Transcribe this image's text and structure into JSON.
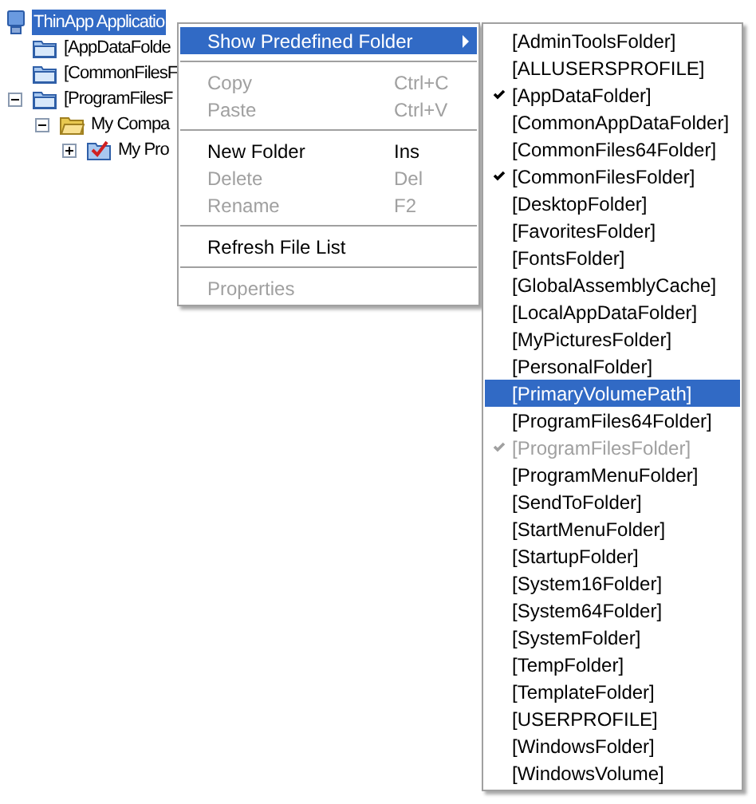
{
  "tree": [
    {
      "label": "ThinApp Applicatio",
      "kind": "computer",
      "selected": true,
      "children": [
        {
          "label": "[AppDataFolde",
          "kind": "folder",
          "selected": false
        },
        {
          "label": "[CommonFilesF",
          "kind": "folder",
          "selected": false
        },
        {
          "label": "[ProgramFilesF",
          "kind": "folder",
          "selected": false,
          "expanded": true,
          "children": [
            {
              "label": "My Compa",
              "kind": "open-folder",
              "selected": false,
              "expanded": true,
              "children": [
                {
                  "label": "My Pro",
                  "kind": "checked-folder",
                  "selected": false,
                  "expanded": false
                }
              ]
            }
          ]
        }
      ]
    }
  ],
  "context_menu": [
    {
      "kind": "item",
      "label": "Show Predefined Folder",
      "selected": true,
      "disabled": false,
      "submenu": true
    },
    {
      "kind": "separator"
    },
    {
      "kind": "item",
      "label": "Copy",
      "shortcut": "Ctrl+C",
      "selected": false,
      "disabled": true
    },
    {
      "kind": "item",
      "label": "Paste",
      "shortcut": "Ctrl+V",
      "selected": false,
      "disabled": true
    },
    {
      "kind": "separator"
    },
    {
      "kind": "item",
      "label": "New Folder",
      "shortcut": "Ins",
      "selected": false,
      "disabled": false
    },
    {
      "kind": "item",
      "label": "Delete",
      "shortcut": "Del",
      "selected": false,
      "disabled": true
    },
    {
      "kind": "item",
      "label": "Rename",
      "shortcut": "F2",
      "selected": false,
      "disabled": true
    },
    {
      "kind": "separator"
    },
    {
      "kind": "item",
      "label": "Refresh File List",
      "selected": false,
      "disabled": false
    },
    {
      "kind": "separator"
    },
    {
      "kind": "item",
      "label": "Properties",
      "selected": false,
      "disabled": true
    }
  ],
  "submenu": [
    {
      "label": "[AdminToolsFolder]",
      "checked": false,
      "disabled": false,
      "selected": false
    },
    {
      "label": "[ALLUSERSPROFILE]",
      "checked": false,
      "disabled": false,
      "selected": false
    },
    {
      "label": "[AppDataFolder]",
      "checked": true,
      "disabled": false,
      "selected": false
    },
    {
      "label": "[CommonAppDataFolder]",
      "checked": false,
      "disabled": false,
      "selected": false
    },
    {
      "label": "[CommonFiles64Folder]",
      "checked": false,
      "disabled": false,
      "selected": false
    },
    {
      "label": "[CommonFilesFolder]",
      "checked": true,
      "disabled": false,
      "selected": false
    },
    {
      "label": "[DesktopFolder]",
      "checked": false,
      "disabled": false,
      "selected": false
    },
    {
      "label": "[FavoritesFolder]",
      "checked": false,
      "disabled": false,
      "selected": false
    },
    {
      "label": "[FontsFolder]",
      "checked": false,
      "disabled": false,
      "selected": false
    },
    {
      "label": "[GlobalAssemblyCache]",
      "checked": false,
      "disabled": false,
      "selected": false
    },
    {
      "label": "[LocalAppDataFolder]",
      "checked": false,
      "disabled": false,
      "selected": false
    },
    {
      "label": "[MyPicturesFolder]",
      "checked": false,
      "disabled": false,
      "selected": false
    },
    {
      "label": "[PersonalFolder]",
      "checked": false,
      "disabled": false,
      "selected": false
    },
    {
      "label": "[PrimaryVolumePath]",
      "checked": false,
      "disabled": false,
      "selected": true
    },
    {
      "label": "[ProgramFiles64Folder]",
      "checked": false,
      "disabled": false,
      "selected": false
    },
    {
      "label": "[ProgramFilesFolder]",
      "checked": true,
      "disabled": true,
      "selected": false
    },
    {
      "label": "[ProgramMenuFolder]",
      "checked": false,
      "disabled": false,
      "selected": false
    },
    {
      "label": "[SendToFolder]",
      "checked": false,
      "disabled": false,
      "selected": false
    },
    {
      "label": "[StartMenuFolder]",
      "checked": false,
      "disabled": false,
      "selected": false
    },
    {
      "label": "[StartupFolder]",
      "checked": false,
      "disabled": false,
      "selected": false
    },
    {
      "label": "[System16Folder]",
      "checked": false,
      "disabled": false,
      "selected": false
    },
    {
      "label": "[System64Folder]",
      "checked": false,
      "disabled": false,
      "selected": false
    },
    {
      "label": "[SystemFolder]",
      "checked": false,
      "disabled": false,
      "selected": false
    },
    {
      "label": "[TempFolder]",
      "checked": false,
      "disabled": false,
      "selected": false
    },
    {
      "label": "[TemplateFolder]",
      "checked": false,
      "disabled": false,
      "selected": false
    },
    {
      "label": "[USERPROFILE]",
      "checked": false,
      "disabled": false,
      "selected": false
    },
    {
      "label": "[WindowsFolder]",
      "checked": false,
      "disabled": false,
      "selected": false
    },
    {
      "label": "[WindowsVolume]",
      "checked": false,
      "disabled": false,
      "selected": false
    }
  ]
}
